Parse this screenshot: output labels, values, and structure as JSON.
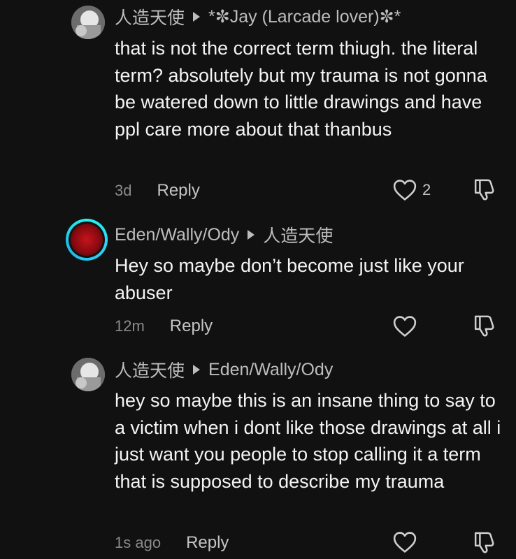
{
  "comments": [
    {
      "author": "人造天使",
      "reply_to": "*✼Jay (Larcade lover)✼*",
      "text": "that is not the correct term thiugh. the literal term? absolutely but my trauma is not gonna be watered down to little drawings and have ppl care more about that thanbus",
      "time": "3d",
      "reply_label": "Reply",
      "likes": "2",
      "avatar": "gray-avatar"
    },
    {
      "author": "Eden/Wally/Ody",
      "reply_to": "人造天使",
      "text": "Hey so maybe don’t become just like your abuser",
      "time": "12m",
      "reply_label": "Reply",
      "likes": "",
      "avatar": "red-avatar-with-story-ring"
    },
    {
      "author": "人造天使",
      "reply_to": "Eden/Wally/Ody",
      "text": "hey so maybe this is an insane thing to say to a victim when i dont like those drawings at all i just want you people to stop calling it a term that is supposed to describe my trauma",
      "time": "1s ago",
      "reply_label": "Reply",
      "likes": "",
      "avatar": "gray-avatar"
    }
  ],
  "icons": {
    "like": "heart-outline-icon",
    "dislike": "thumbs-down-outline-icon",
    "reply_arrow": "triangle-right-icon"
  },
  "colors": {
    "background": "#111111",
    "text": "#f4f4f4",
    "muted": "#8a8a8a",
    "story_ring": "#25f4ee"
  }
}
